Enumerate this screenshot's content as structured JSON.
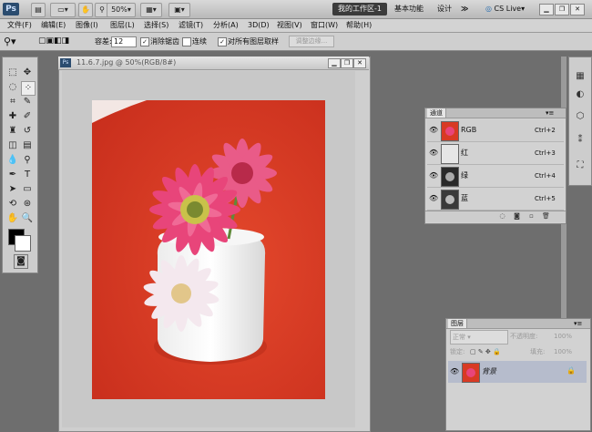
{
  "appbar": {
    "logo": "Ps",
    "zoom": "50%",
    "workspace_active": "我的工作区-1",
    "workspace_basic": "基本功能",
    "workspace_design": "设计",
    "more": "≫",
    "cslive": "CS Live▾"
  },
  "menu": [
    "文件(F)",
    "编辑(E)",
    "图像(I)",
    "图层(L)",
    "选择(S)",
    "滤镜(T)",
    "分析(A)",
    "3D(D)",
    "视图(V)",
    "窗口(W)",
    "帮助(H)"
  ],
  "options": {
    "tolerance_label": "容差:",
    "tolerance_value": "12",
    "antialias_label": "消除锯齿",
    "contiguous_label": "连续",
    "sample_all_label": "对所有图层取样",
    "refine_label": "调整边缘..."
  },
  "document": {
    "icon": "Ps",
    "title": "11.6.7.jpg @ 50%(RGB/8#)"
  },
  "channels": {
    "tab": "通道",
    "rows": [
      {
        "name": "RGB",
        "key": "Ctrl+2"
      },
      {
        "name": "红",
        "key": "Ctrl+3"
      },
      {
        "name": "绿",
        "key": "Ctrl+4"
      },
      {
        "name": "蓝",
        "key": "Ctrl+5"
      }
    ]
  },
  "layers": {
    "tab": "图层",
    "blend_mode": "正常",
    "opacity_label": "不透明度:",
    "opacity_value": "100%",
    "lock_label": "锁定:",
    "fill_label": "填充:",
    "fill_value": "100%",
    "layer_name": "背景"
  },
  "colors": {
    "foreground": "#000000",
    "background": "#ffffff",
    "photo_red": "#d83a24",
    "flower_pink": "#e8457a"
  }
}
